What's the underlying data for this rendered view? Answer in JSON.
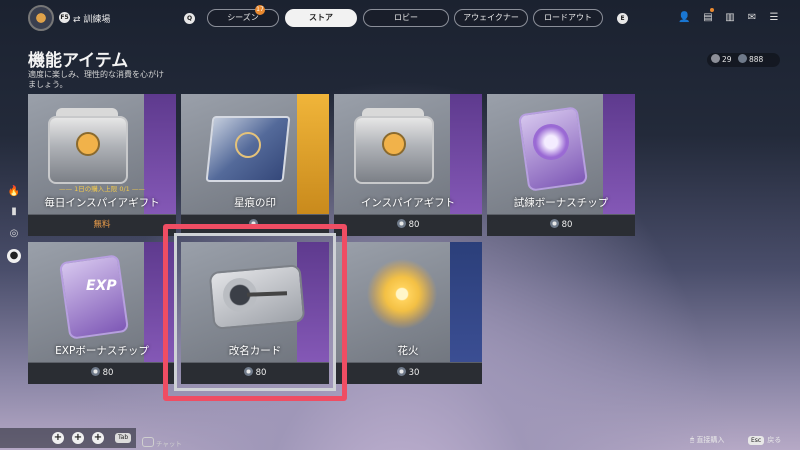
{
  "topbar": {
    "left_key": "F5",
    "mode_label": "⇄ 訓練場",
    "left_nav_key": "Q",
    "right_nav_key": "E",
    "season_badge": "17",
    "tabs": [
      {
        "label": "シーズン",
        "active": false
      },
      {
        "label": "ストア",
        "active": true
      },
      {
        "label": "ロビー",
        "active": false
      },
      {
        "label": "アウェイクナー",
        "active": false
      },
      {
        "label": "ロードアウト",
        "active": false
      }
    ]
  },
  "page": {
    "title": "機能アイテム",
    "subtitle": "適度に楽しみ、理性的な消費を心がけましょう。"
  },
  "currency": {
    "a_value": "29",
    "b_value": "888"
  },
  "items": [
    {
      "name": "毎日インスパイアギフト",
      "price": "無料",
      "free": true,
      "limit": "—— 1日の購入上限 0/1 ——",
      "stripe": "purple"
    },
    {
      "name": "星痕の印",
      "price": "",
      "free": false,
      "limit": "",
      "stripe": "gold"
    },
    {
      "name": "インスパイアギフト",
      "price": "80",
      "free": false,
      "limit": "",
      "stripe": "purple"
    },
    {
      "name": "試練ボーナスチップ",
      "price": "80",
      "free": false,
      "limit": "",
      "stripe": "purple"
    },
    {
      "name": "EXPボーナスチップ",
      "price": "80",
      "free": false,
      "limit": "",
      "stripe": "purple",
      "badge": "EXP"
    },
    {
      "name": "改名カード",
      "price": "80",
      "free": false,
      "limit": "",
      "stripe": "purple"
    },
    {
      "name": "花火",
      "price": "30",
      "free": false,
      "limit": "",
      "stripe": "blue"
    }
  ],
  "bottom": {
    "tab_key": "Tab",
    "chat_label": "チャット",
    "purchase_label": "直接購入",
    "esc_key": "Esc",
    "back_label": "戻る"
  }
}
